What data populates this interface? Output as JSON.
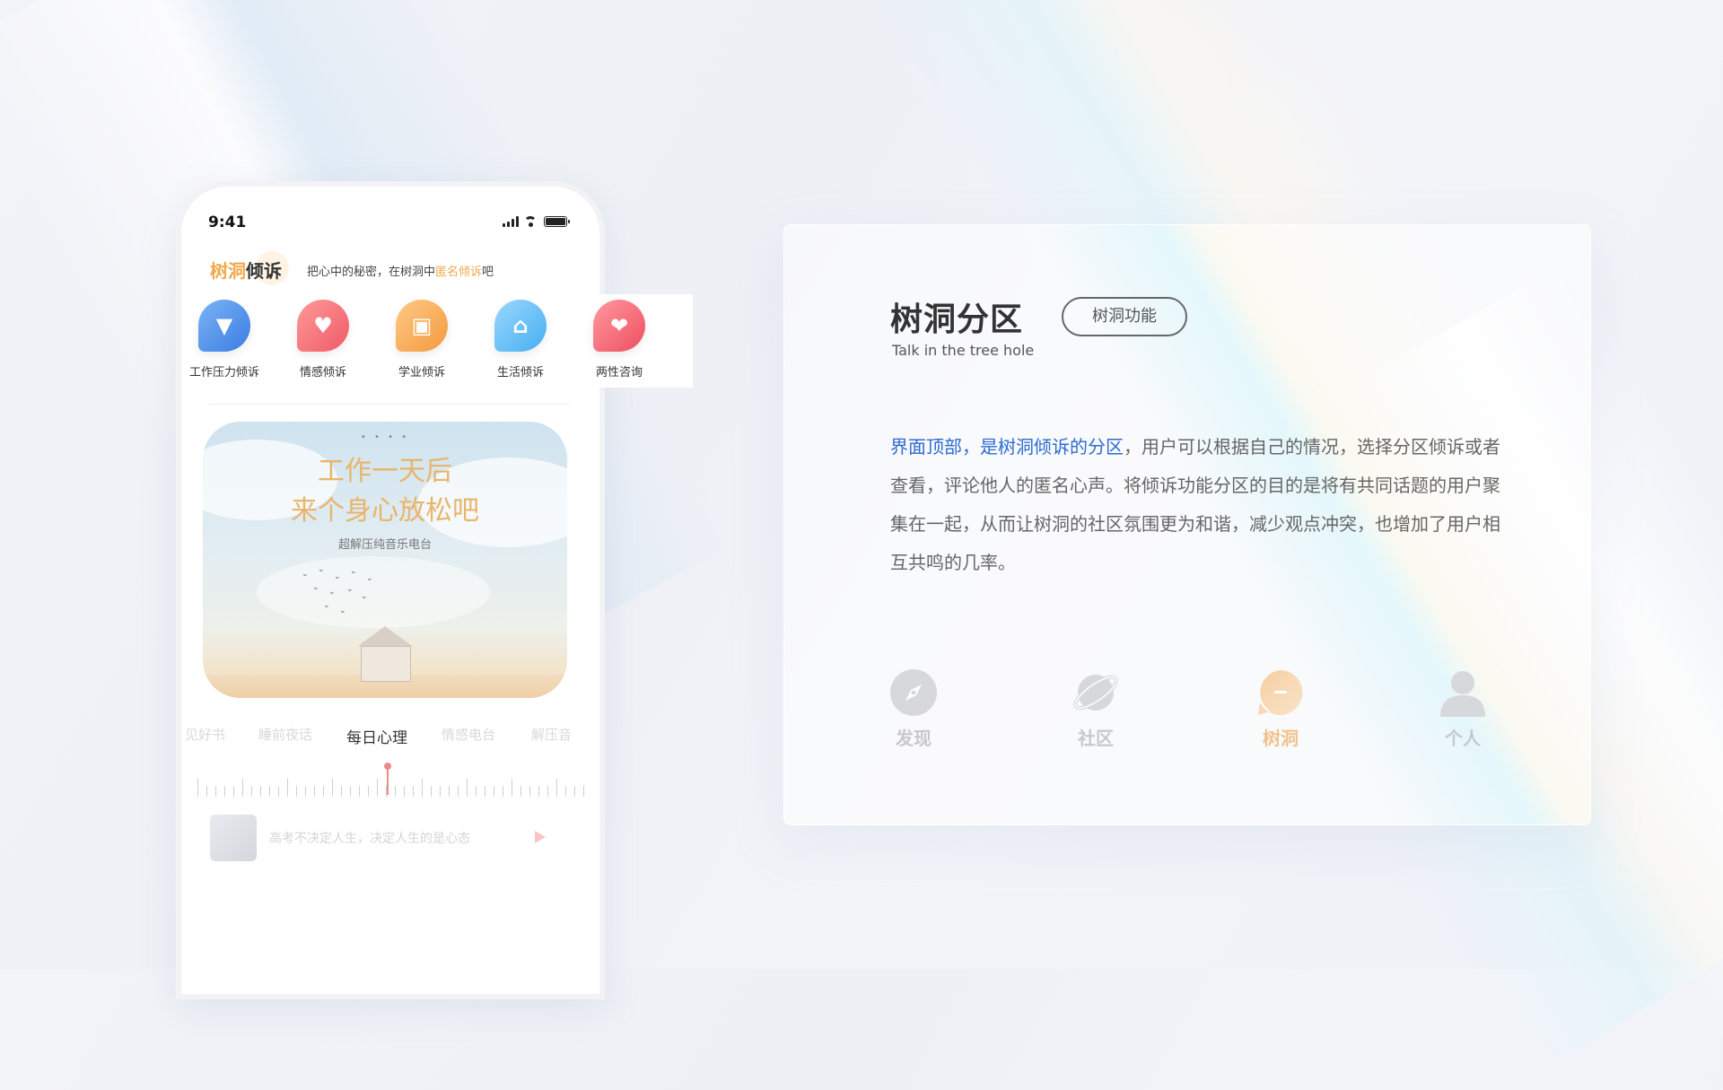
{
  "phone": {
    "status": {
      "time": "9:41"
    },
    "header": {
      "title_accent": "树洞",
      "title_rest": "倾诉",
      "subtitle_pre": "把心中的秘密，在树洞中",
      "subtitle_highlight": "匿名倾诉",
      "subtitle_post": "吧"
    },
    "categories": [
      {
        "label": "工作压力倾诉",
        "icon": "tie-icon",
        "color": "#3f87e8"
      },
      {
        "label": "情感倾诉",
        "icon": "heart-icon",
        "color": "#f2646a"
      },
      {
        "label": "学业倾诉",
        "icon": "book-icon",
        "color": "#f6a54a"
      },
      {
        "label": "生活倾诉",
        "icon": "house-icon",
        "color": "#54b8f2"
      },
      {
        "label": "两性咨询",
        "icon": "hearts-icon",
        "color": "#f45f6c"
      }
    ],
    "banner": {
      "line1": "工作一天后",
      "line2": "来个身心放松吧",
      "line3": "超解压纯音乐电台",
      "dots": "• • • •"
    },
    "tabs": [
      {
        "label": "见好书"
      },
      {
        "label": "睡前夜话"
      },
      {
        "label": "每日心理",
        "active": true
      },
      {
        "label": "情感电台"
      },
      {
        "label": "解压音"
      }
    ],
    "item": {
      "text": "高考不决定人生，决定人生的是心态"
    }
  },
  "card": {
    "title": "树洞分区",
    "subtitle": "Talk in the tree hole",
    "tag": "树洞功能",
    "para_highlight": "界面顶部，是树洞倾诉的分区",
    "para_rest": "，用户可以根据自己的情况，选择分区倾诉或者查看，评论他人的匿名心声。将倾诉功能分区的目的是将有共同话题的用户聚集在一起，从而让树洞的社区氛围更为和谐，减少观点冲突，也增加了用户相互共鸣的几率。",
    "nav": [
      {
        "label": "发现",
        "icon": "compass-icon"
      },
      {
        "label": "社区",
        "icon": "planet-icon"
      },
      {
        "label": "树洞",
        "icon": "treehole-icon",
        "active": true
      },
      {
        "label": "个人",
        "icon": "person-icon"
      }
    ]
  },
  "colors": {
    "accent_orange": "#f1a94c",
    "highlight_blue": "#2c6bd1",
    "text_dark": "#333333",
    "text_gray": "#666666"
  }
}
